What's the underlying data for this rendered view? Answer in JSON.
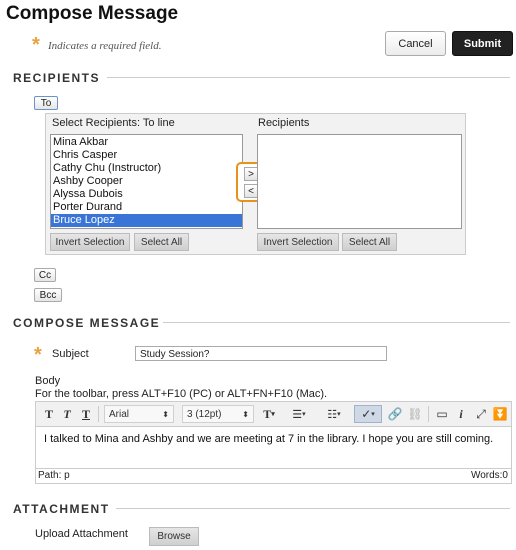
{
  "page": {
    "title": "Compose Message"
  },
  "required_note": {
    "star": "*",
    "text": "Indicates a required field."
  },
  "actions": {
    "cancel": "Cancel",
    "submit": "Submit"
  },
  "recipients_section": {
    "heading": "RECIPIENTS",
    "to_button": "To",
    "cc_button": "Cc",
    "bcc_button": "Bcc",
    "select_label": "Select Recipients: To line",
    "recipients_label": "Recipients",
    "available": [
      "Mina Akbar",
      "Chris Casper",
      "Cathy Chu (Instructor)",
      "Ashby Cooper",
      "Alyssa Dubois",
      "Porter Durand",
      "Bruce Lopez"
    ],
    "selected_index": 6,
    "move_right": ">",
    "move_left": "<",
    "left_invert": "Invert Selection",
    "left_select_all": "Select All",
    "right_invert": "Invert Selection",
    "right_select_all": "Select All"
  },
  "compose_section": {
    "heading": "COMPOSE MESSAGE",
    "subject_label": "Subject",
    "subject_value": "Study Session?",
    "body_label": "Body",
    "toolbar_hint": "For the toolbar, press ALT+F10 (PC) or ALT+FN+F10 (Mac).",
    "font_family": "Arial",
    "font_size": "3 (12pt)",
    "body_text": "I talked to Mina and Ashby and we are meeting at 7 in the library. I hope you are still coming.",
    "path": "Path: p",
    "words": "Words:0"
  },
  "attachment_section": {
    "heading": "ATTACHMENT",
    "upload_label": "Upload Attachment",
    "browse": "Browse"
  }
}
